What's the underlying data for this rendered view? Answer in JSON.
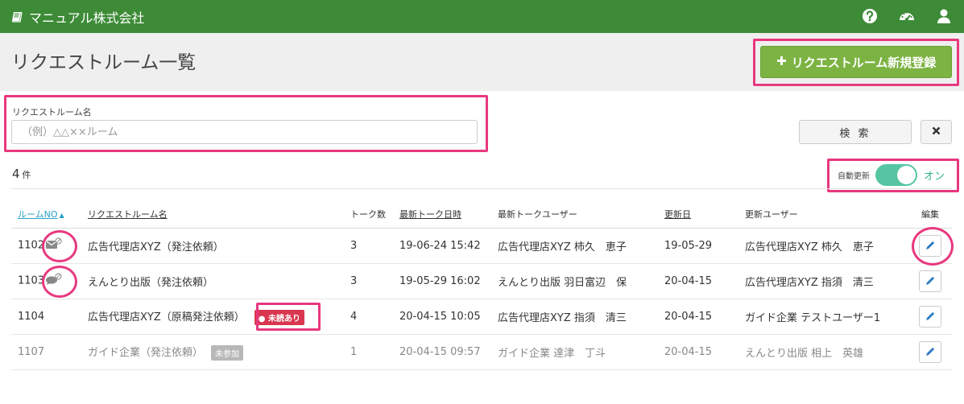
{
  "app": {
    "title": "マニュアル株式会社"
  },
  "topbar": {
    "icons": [
      "help-icon",
      "dashboard-icon",
      "user-icon"
    ]
  },
  "page": {
    "title": "リクエストルーム一覧"
  },
  "actions": {
    "new_room_label": "リクエストルーム新規登録"
  },
  "search": {
    "label": "リクエストルーム名",
    "placeholder": "（例）△△××ルーム",
    "value": "",
    "search_button": "検 索"
  },
  "summary": {
    "count": "4",
    "unit": "件"
  },
  "auto_refresh": {
    "label": "自動更新",
    "state": "オン",
    "enabled": true
  },
  "colors": {
    "header": "#3d8b37",
    "primary_button": "#7cb342",
    "toggle": "#55c5a2",
    "highlight": "#e8387f",
    "unread": "#d9364f",
    "sort_link": "#2aa1c9"
  },
  "table": {
    "columns": [
      "ルームNO",
      "リクエストルーム名",
      "トーク数",
      "最新トーク日時",
      "最新トークユーザー",
      "更新日",
      "更新ユーザー",
      "編集"
    ],
    "rows": [
      {
        "no": "1102",
        "name": "広告代理店XYZ（発注依頼）",
        "talks": "3",
        "latest_time": "19-06-24 15:42",
        "latest_user": "広告代理店XYZ 柿久　恵子",
        "updated": "19-05-29",
        "updater": "広告代理店XYZ 柿久　恵子",
        "status_icon": "envelope-muted-icon",
        "badge": ""
      },
      {
        "no": "1103",
        "name": "えんとり出版（発注依頼）",
        "talks": "3",
        "latest_time": "19-05-29 16:02",
        "latest_user": "えんとり出版 羽日富辺　保",
        "updated": "20-04-15",
        "updater": "広告代理店XYZ 指須　清三",
        "status_icon": "comment-muted-icon",
        "badge": ""
      },
      {
        "no": "1104",
        "name": "広告代理店XYZ（原稿発注依頼）",
        "talks": "4",
        "latest_time": "20-04-15 10:05",
        "latest_user": "広告代理店XYZ 指須　清三",
        "updated": "20-04-15",
        "updater": "ガイド企業 テストユーザー1",
        "status_icon": "",
        "badge": "未読あり"
      },
      {
        "no": "1107",
        "name": "ガイド企業（発注依頼）",
        "talks": "1",
        "latest_time": "20-04-15 09:57",
        "latest_user": "ガイド企業 達津　丁斗",
        "updated": "20-04-15",
        "updater": "えんとり出版 相上　英雄",
        "status_icon": "",
        "badge": "未参加"
      }
    ]
  }
}
